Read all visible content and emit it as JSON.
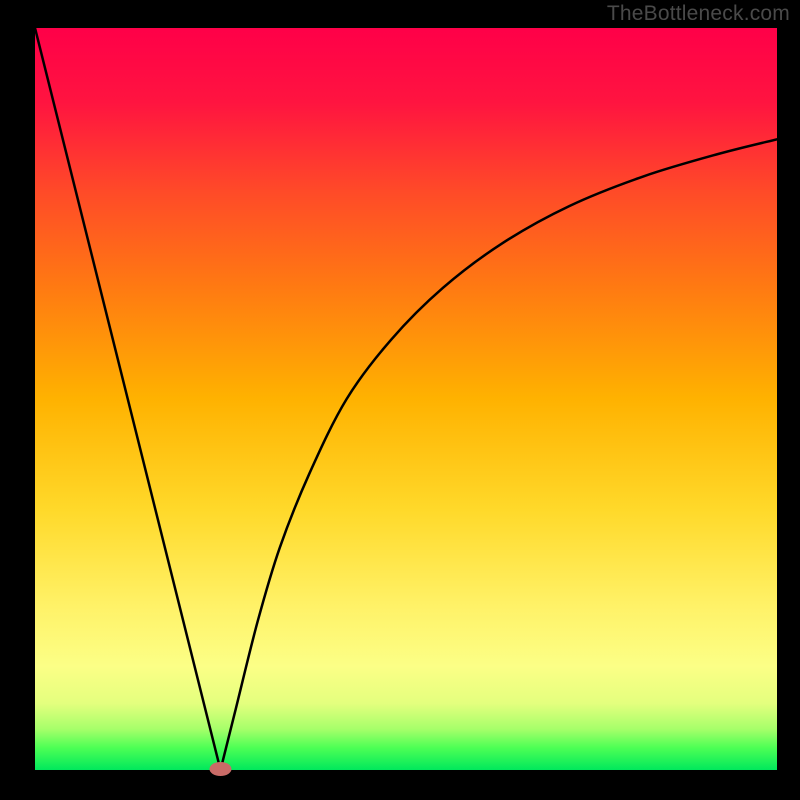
{
  "watermark_text": "TheBottleneck.com",
  "chart_data": {
    "type": "line",
    "title": "",
    "xlabel": "",
    "ylabel": "",
    "xlim": [
      0,
      100
    ],
    "ylim": [
      0,
      100
    ],
    "optimum_x": 25,
    "background": {
      "type": "vertical-gradient",
      "stops": [
        {
          "pos": 0.0,
          "color": "#ff0044"
        },
        {
          "pos": 0.12,
          "color": "#ff1b3a"
        },
        {
          "pos": 0.3,
          "color": "#ff6a1e"
        },
        {
          "pos": 0.5,
          "color": "#ffb300"
        },
        {
          "pos": 0.7,
          "color": "#ffe23a"
        },
        {
          "pos": 0.82,
          "color": "#fff97a"
        },
        {
          "pos": 0.9,
          "color": "#f4ff96"
        },
        {
          "pos": 0.945,
          "color": "#b6ff70"
        },
        {
          "pos": 0.97,
          "color": "#4dff55"
        },
        {
          "pos": 1.0,
          "color": "#00e85a"
        }
      ]
    },
    "marker": {
      "x": 25,
      "y": 0,
      "color": "#c96b67"
    },
    "series": [
      {
        "name": "left-branch",
        "x": [
          0,
          5,
          10,
          15,
          20,
          25
        ],
        "y": [
          100,
          80,
          60,
          40,
          20,
          0
        ]
      },
      {
        "name": "right-branch",
        "x": [
          25,
          27,
          30,
          33,
          37,
          42,
          48,
          55,
          63,
          72,
          82,
          92,
          100
        ],
        "y": [
          0,
          8,
          20,
          30,
          40,
          50,
          58,
          65,
          71,
          76,
          80,
          83,
          85
        ]
      }
    ]
  }
}
